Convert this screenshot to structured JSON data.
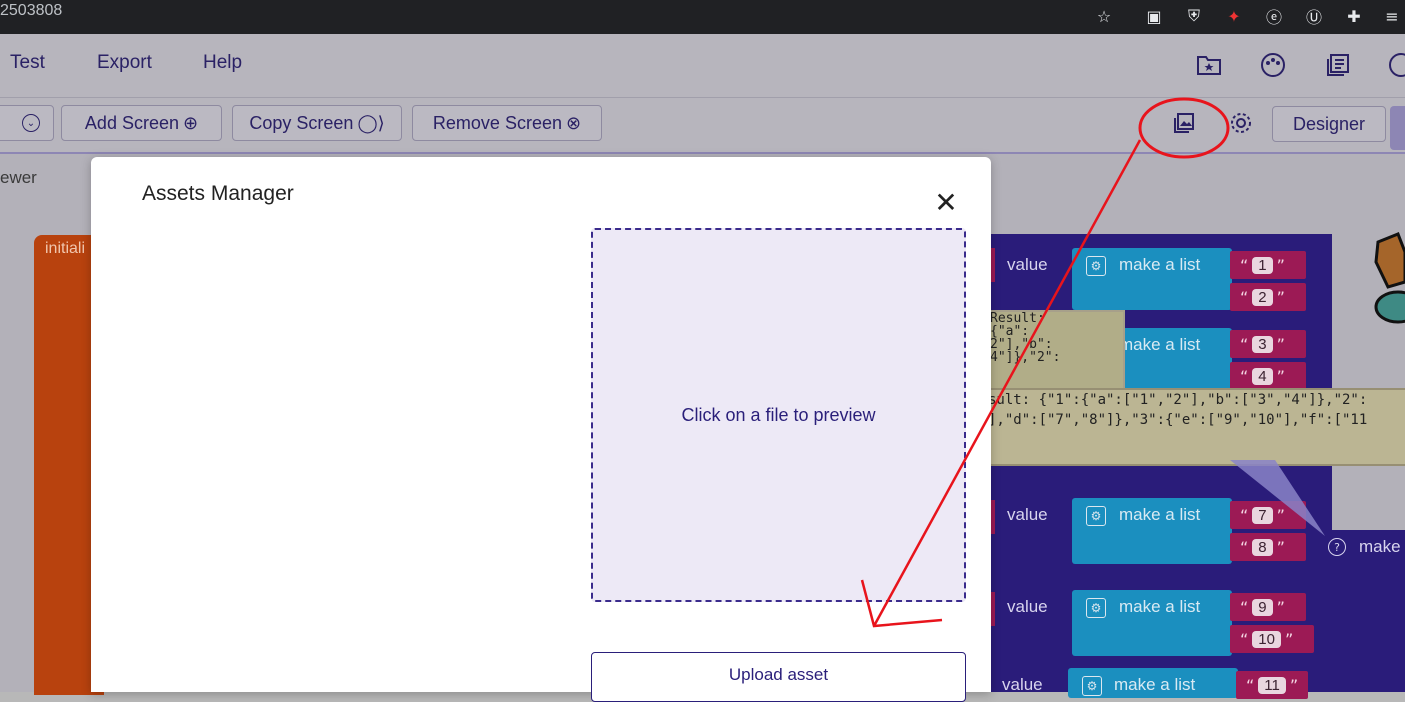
{
  "browser": {
    "url_fragment": "2503808"
  },
  "menu": {
    "items": [
      "Test",
      "Export",
      "Help"
    ]
  },
  "toolbar": {
    "add_screen": "Add Screen",
    "copy_screen": "Copy Screen",
    "remove_screen": "Remove Screen",
    "designer": "Designer",
    "viewer_partial": "ewer"
  },
  "blocks": {
    "initialize_partial": "initiali",
    "value_label": "value",
    "make_a_list": "make a list",
    "make_partial": "make",
    "numbers": [
      "1",
      "2",
      "3",
      "4",
      "7",
      "8",
      "9",
      "10",
      "11"
    ],
    "tooltip_small": "Result:\n{\"a\":\n2\"],\"b\":\n4\"]},\"2\":",
    "tooltip_large": "sult: {\"1\":{\"a\":[\"1\",\"2\"],\"b\":[\"3\",\"4\"]},\"2\":\n],\"d\":[\"7\",\"8\"]},\"3\":{\"e\":[\"9\",\"10\"],\"f\":[\"11"
  },
  "modal": {
    "title": "Assets Manager",
    "preview_text": "Click on a file to preview",
    "upload_label": "Upload asset"
  },
  "colors": {
    "accent": "#2a1f7a",
    "annotation": "#e8141c"
  }
}
